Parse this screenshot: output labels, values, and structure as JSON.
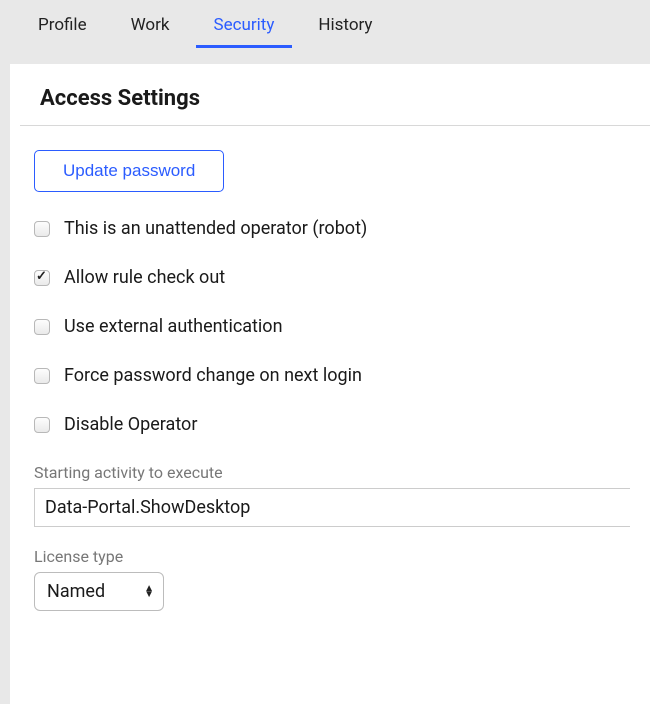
{
  "tabs": {
    "profile": "Profile",
    "work": "Work",
    "security": "Security",
    "history": "History",
    "active": "security"
  },
  "panel": {
    "title": "Access Settings",
    "update_password": "Update password",
    "checkboxes": {
      "unattended": {
        "label": "This is an unattended operator (robot)",
        "checked": false
      },
      "rule_checkout": {
        "label": "Allow rule check out",
        "checked": true
      },
      "external_auth": {
        "label": "Use external authentication",
        "checked": false
      },
      "force_pwd": {
        "label": "Force password change on next login",
        "checked": false
      },
      "disable_op": {
        "label": "Disable Operator",
        "checked": false
      }
    },
    "starting_activity": {
      "label": "Starting activity to execute",
      "value": "Data-Portal.ShowDesktop"
    },
    "license_type": {
      "label": "License type",
      "value": "Named"
    }
  }
}
